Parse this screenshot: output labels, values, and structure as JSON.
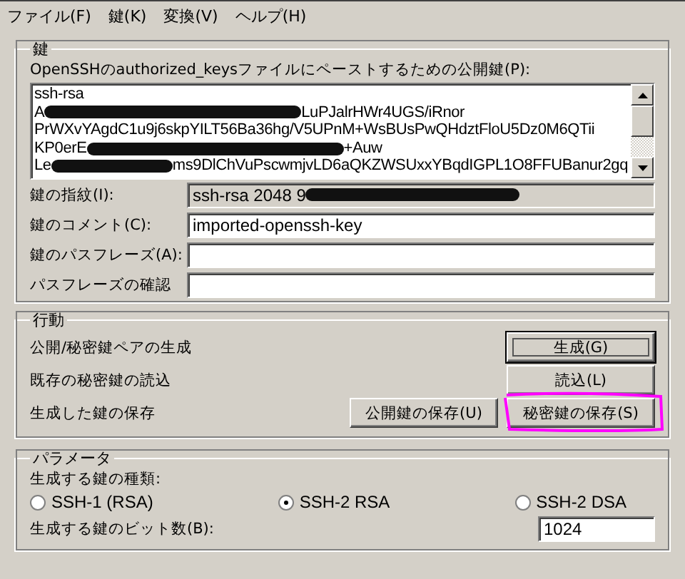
{
  "menu": [
    {
      "label": "ファイル(F)"
    },
    {
      "label": "鍵(K)"
    },
    {
      "label": "変換(V)"
    },
    {
      "label": "ヘルプ(H)"
    }
  ],
  "key_group": {
    "title": "鍵",
    "public_key_label": "OpenSSHのauthorized_keysファイルにペーストするための公開鍵(P):",
    "public_key_lines": [
      [
        {
          "text": "ssh-rsa"
        }
      ],
      [
        {
          "text": "A"
        },
        {
          "kind": "redacted"
        },
        {
          "text": "LuPJalrHWr4UGS/iRnor"
        }
      ],
      [
        {
          "text": "PrWXvYAgdC1u9j6skpYILT56Ba36hg/V5UPnM+WsBUsPwQHdztFloU5Dz0M6QTii"
        }
      ],
      [
        {
          "text": "KP0erE"
        },
        {
          "kind": "redacted"
        },
        {
          "text": "+Auw"
        }
      ],
      [
        {
          "text": "Le"
        },
        {
          "kind": "redacted"
        },
        {
          "text": "ms9DlChVuPscwmjvLD6aQKZWSUxxYBqdIGPL1O8FFUBanur2gq"
        }
      ]
    ],
    "fields": [
      {
        "label": "鍵の指紋(I):",
        "value": "ssh-rsa 2048 9",
        "redacted": true,
        "disabled": true
      },
      {
        "label": "鍵のコメント(C):",
        "value": "imported-openssh-key",
        "disabled": false
      },
      {
        "label": "鍵のパスフレーズ(A):",
        "disabled": false
      },
      {
        "label": "パスフレーズの確認",
        "disabled": false
      }
    ]
  },
  "actions": {
    "title": "行動",
    "rows": [
      {
        "label": "公開/秘密鍵ペアの生成",
        "buttons": [
          {
            "label": "生成(G)",
            "default": true,
            "highlighted": false
          }
        ]
      },
      {
        "label": "既存の秘密鍵の読込",
        "buttons": [
          {
            "label": "読込(L)",
            "default": false,
            "highlighted": false
          }
        ]
      },
      {
        "label": "生成した鍵の保存",
        "buttons": [
          {
            "label": "公開鍵の保存(U)",
            "default": false,
            "highlighted": false
          },
          {
            "label": "秘密鍵の保存(S)",
            "default": false,
            "highlighted": true
          }
        ]
      }
    ]
  },
  "parameters": {
    "title": "パラメータ",
    "type_label": "生成する鍵の種類:",
    "types": [
      {
        "label": "SSH-1 (RSA)",
        "selected": false
      },
      {
        "label": "SSH-2 RSA",
        "selected": true
      },
      {
        "label": "SSH-2 DSA",
        "selected": false
      }
    ],
    "bits_label": "生成する鍵のビット数(B):",
    "bits": "1024"
  }
}
